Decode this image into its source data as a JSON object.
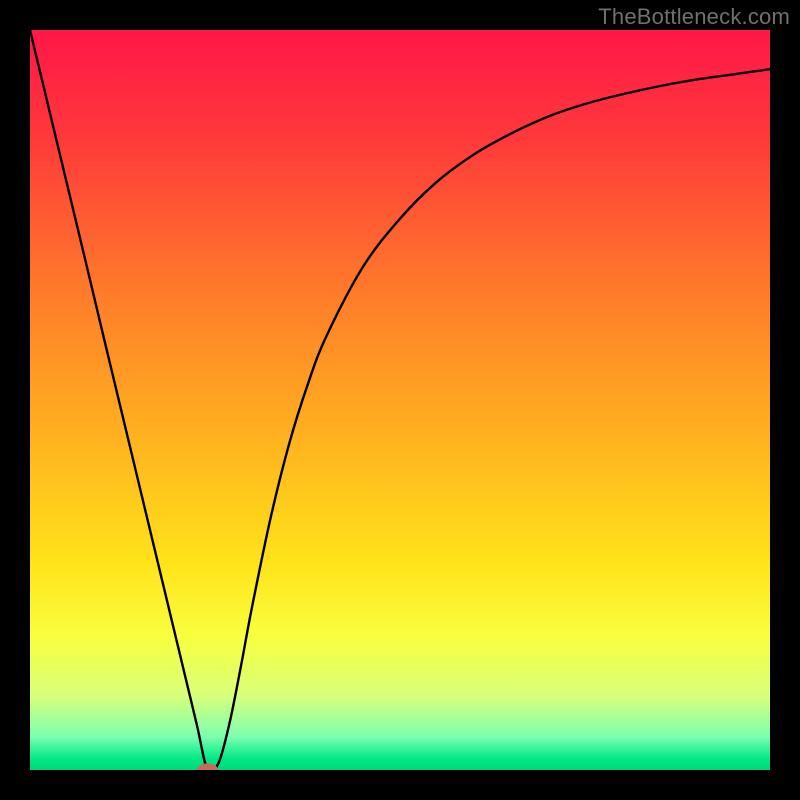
{
  "watermark": "TheBottleneck.com",
  "chart_data": {
    "type": "line",
    "title": "",
    "xlabel": "",
    "ylabel": "",
    "xlim": [
      0,
      100
    ],
    "ylim": [
      0,
      100
    ],
    "background_gradient": {
      "stops": [
        {
          "offset": 0.0,
          "color": "#ff1748"
        },
        {
          "offset": 0.15,
          "color": "#ff3a3a"
        },
        {
          "offset": 0.35,
          "color": "#ff7a2a"
        },
        {
          "offset": 0.55,
          "color": "#ffb21f"
        },
        {
          "offset": 0.72,
          "color": "#ffe31a"
        },
        {
          "offset": 0.82,
          "color": "#f9ff3f"
        },
        {
          "offset": 0.9,
          "color": "#d8ff7a"
        },
        {
          "offset": 0.955,
          "color": "#7cffb0"
        },
        {
          "offset": 0.985,
          "color": "#00e885"
        },
        {
          "offset": 1.0,
          "color": "#00d877"
        }
      ]
    },
    "series": [
      {
        "name": "bottleneck-curve",
        "color": "#000000",
        "width": 2.4,
        "x": [
          0.0,
          2.5,
          5.0,
          7.5,
          10.0,
          12.5,
          15.0,
          17.5,
          20.0,
          22.5,
          24.0,
          25.5,
          27.0,
          28.5,
          30.0,
          32.5,
          35.0,
          37.5,
          40.0,
          45.0,
          50.0,
          55.0,
          60.0,
          65.0,
          70.0,
          75.0,
          80.0,
          85.0,
          90.0,
          95.0,
          100.0
        ],
        "y": [
          100.0,
          89.6,
          79.2,
          68.8,
          58.3,
          47.9,
          37.5,
          27.1,
          16.7,
          6.3,
          0.0,
          1.0,
          6.5,
          14.0,
          22.0,
          34.0,
          44.0,
          52.0,
          58.5,
          68.0,
          74.5,
          79.5,
          83.2,
          86.0,
          88.3,
          90.0,
          91.3,
          92.4,
          93.3,
          94.0,
          94.7
        ]
      }
    ],
    "marker": {
      "name": "bottleneck-point",
      "x": 24.0,
      "y": 0.0,
      "rx": 1.4,
      "ry": 0.9,
      "fill": "#c96a5a"
    }
  }
}
